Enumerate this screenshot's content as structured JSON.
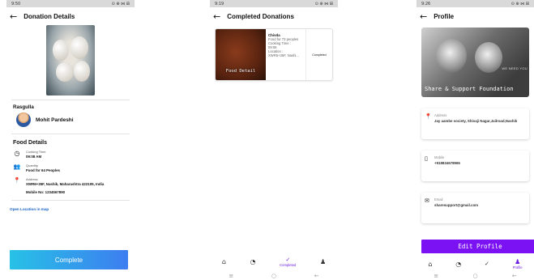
{
  "screen1": {
    "status": {
      "left": "9:50",
      "right": "⊙ ⊕ ⋈ ⊞"
    },
    "title": "Donation Details",
    "food_name": "Rasgulla",
    "donor_name": "Mohit Pardeshi",
    "section_title": "Food Details",
    "details": [
      {
        "icon": "clock-icon",
        "glyph": "◷",
        "label": "Cooking Time",
        "value": "09:08 AM"
      },
      {
        "icon": "people-icon",
        "glyph": "👥",
        "label": "Quantity",
        "value": "Food for 64 Peoples"
      },
      {
        "icon": "location-pin-icon",
        "glyph": "📍",
        "label": "Address",
        "value": "XWR6+35F, Nashik, Maharashtra 422105, India"
      }
    ],
    "mobile_line": "Mobile No: 1234567890",
    "map_link": "Open Location in map",
    "complete_label": "Complete"
  },
  "screen2": {
    "status": {
      "left": "9:19",
      "right": "⊙ ⊕ ⋈ ⊞"
    },
    "title": "Completed Donations",
    "card": {
      "image_overlay": "Food Detail",
      "name": "Chivda",
      "line1": "Food for 73 peoples",
      "line2": "Cooking Time :",
      "line3": "09:06",
      "line4": "Location :",
      "line5": "XWR6+35F, Nashi...",
      "status": "Completed"
    },
    "nav": {
      "active_label": "Completed"
    }
  },
  "screen3": {
    "status": {
      "left": "9:26",
      "right": "⊙ ⊕ ⋈ ⊞"
    },
    "title": "Profile",
    "hero_tag": "WE NEED YOU",
    "hero_text": "Share & Support Foundation",
    "address_label": "Address",
    "address_value": "Jay aambe society, Shivaji Nagar,Jailroad,Nashik",
    "mobile_label": "Mobile",
    "mobile_value": "+918834678965",
    "email_label": "Email",
    "email_value": "sharesupport@gmail.com",
    "edit_label": "Edit Profile",
    "nav": {
      "active_label": "Profile"
    }
  },
  "colors": {
    "accent_purple": "#7a12f4",
    "complete_gradient_start": "#27c1e6",
    "complete_gradient_end": "#3d7ef0",
    "link_blue": "#1a64c8"
  }
}
